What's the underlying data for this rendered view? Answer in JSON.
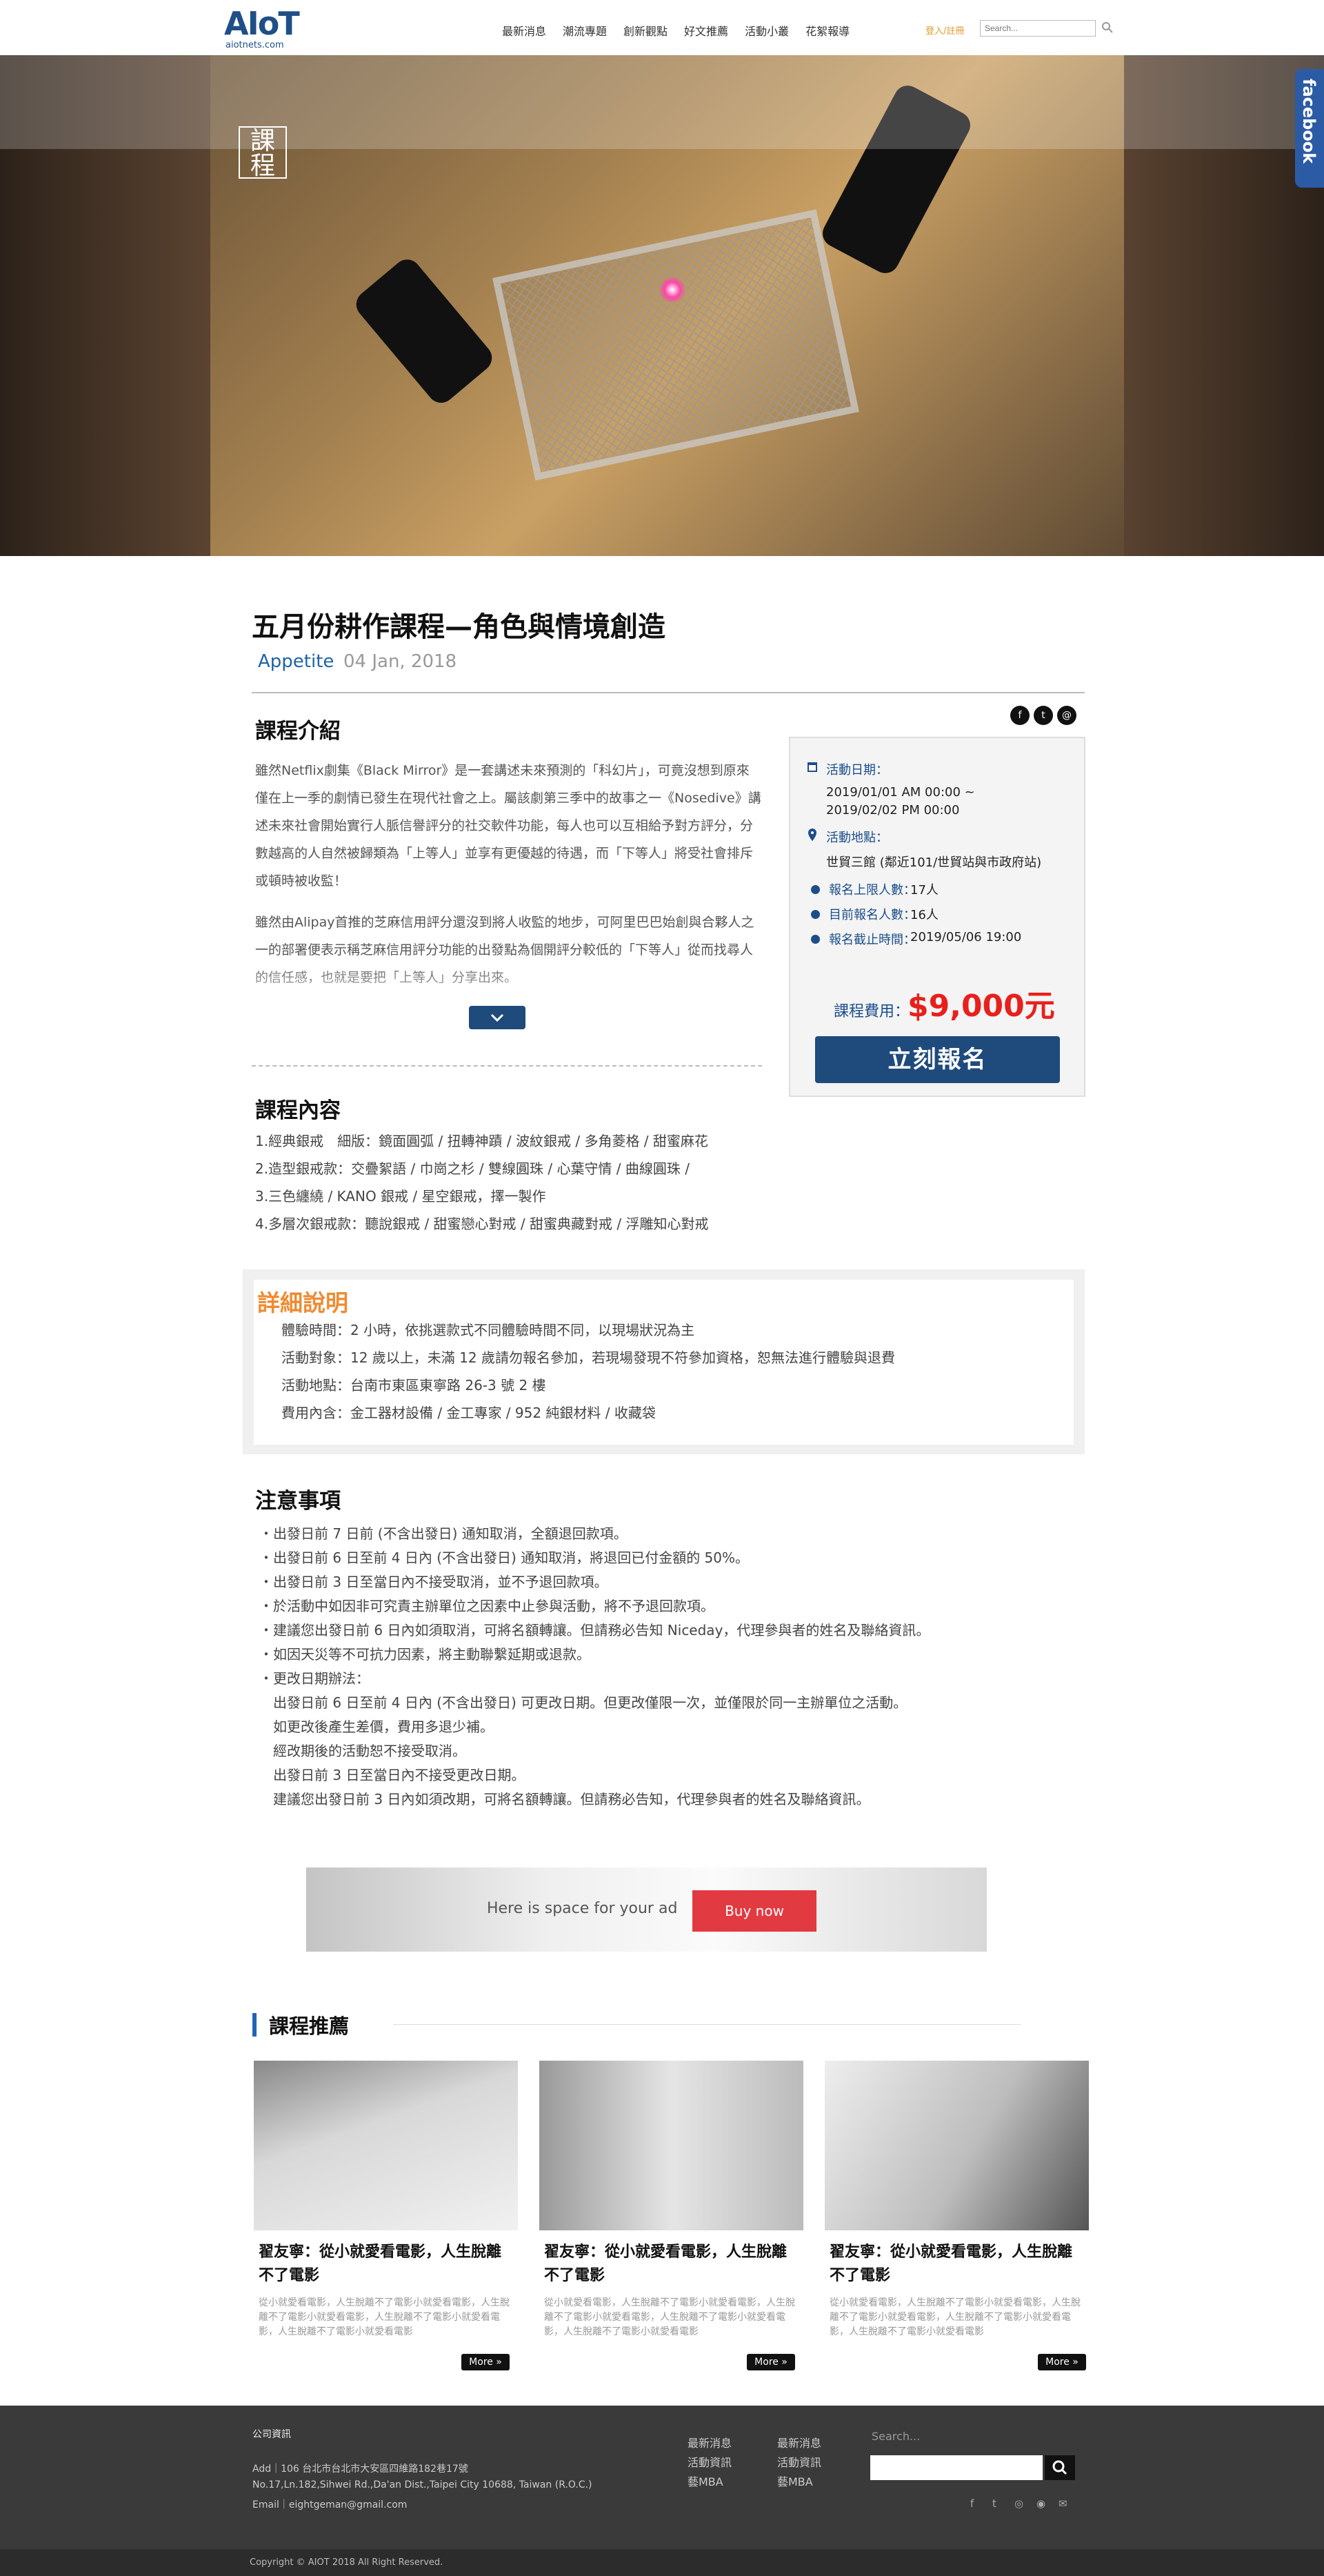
{
  "header": {
    "logo_text": "AIoT",
    "logo_sub": "aiotnets.com",
    "nav": [
      "最新消息",
      "潮流專題",
      "創新觀點",
      "好文推薦",
      "活動小叢",
      "花絮報導"
    ],
    "login": "登入/註冊",
    "search_placeholder": "Search..."
  },
  "hero": {
    "tag": "課程",
    "dots": 8,
    "active_dot": 2
  },
  "facebook_tab": "facebook",
  "article": {
    "title": "五月份耕作課程—角色與情境創造",
    "category": "Appetite",
    "date": "04 Jan, 2018"
  },
  "intro": {
    "heading": "課程介紹",
    "p1": "雖然Netflix劇集《Black Mirror》是一套講述未來預測的「科幻片」，可竟沒想到原來僅在上一季的劇情已發生在現代社會之上。屬該劇第三季中的故事之一《Nosedive》講述未來社會開始實行人脈信譽評分的社交軟件功能，每人也可以互相給予對方評分，分數越高的人自然被歸類為「上等人」並享有更優越的待遇，而「下等人」將受社會排斥或頓時被收監！",
    "p2": "雖然由Alipay首推的芝麻信用評分還沒到將人收監的地步，可阿里巴巴始創與合夥人之一的部署便表示稱芝麻信用評分功能的出發點為個開評分較低的「下等人」從而找尋人的信任感，也就是要把「上等人」分享出來。"
  },
  "social": [
    "f",
    "t",
    "@"
  ],
  "info": {
    "date_label": "活動日期：",
    "date_value_1": "2019/01/01  AM 00:00 ~",
    "date_value_2": "2019/02/02  PM 00:00",
    "place_label": "活動地點：",
    "place_value": "世貿三館 (鄰近101/世貿站與市政府站)",
    "max_label": "報名上限人數：",
    "max_value": "17人",
    "cur_label": "目前報名人數：",
    "cur_value": "16人",
    "deadline_label": "報名截止時間：",
    "deadline_value": "2019/05/06 19:00",
    "fee_label": "課程費用：",
    "fee_value": "$9,000元",
    "register": "立刻報名"
  },
  "content": {
    "heading": "課程內容",
    "items": [
      "1.經典銀戒　細版：鏡面圓弧 / 扭轉神蹟 / 波紋銀戒 / 多角菱格 / 甜蜜麻花",
      "2.造型銀戒款：交疊絮語 / 巾崗之杉 / 雙線圓珠 / 心葉守情 / 曲線圓珠 /",
      "3.三色纏繞 / KANO 銀戒 / 星空銀戒，擇一製作",
      "4.多層次銀戒款：聽說銀戒 / 甜蜜戀心對戒 / 甜蜜典藏對戒 / 浮雕知心對戒"
    ]
  },
  "detail": {
    "heading": "詳細說明",
    "items": [
      "體驗時間：2 小時，依挑選款式不同體驗時間不同，以現場狀況為主",
      "活動對象：12 歲以上，未滿 12 歲請勿報名參加，若現場發現不符參加資格，恕無法進行體驗與退費",
      "活動地點：台南市東區東寧路 26-3 號 2 樓",
      "費用內含：金工器材設備 / 金工專家 / 952 純銀材料 / 收藏袋"
    ]
  },
  "notes": {
    "heading": "注意事項",
    "items": [
      "・出發日前 7 日前 (不含出發日) 通知取消，全額退回款項。",
      "・出發日前 6 日至前 4 日內 (不含出發日) 通知取消，將退回已付金額的 50%。",
      "・出發日前 3 日至當日內不接受取消，並不予退回款項。",
      "・於活動中如因非可究責主辦單位之因素中止參與活動，將不予退回款項。",
      "・建議您出發日前 6 日內如須取消，可將名額轉讓。但請務必告知 Niceday，代理參與者的姓名及聯絡資訊。",
      "・如因天災等不可抗力因素，將主動聯繫延期或退款。",
      "・更改日期辦法：",
      "　出發日前 6 日至前 4 日內 (不含出發日) 可更改日期。但更改僅限一次，並僅限於同一主辦單位之活動。",
      "　如更改後產生差價，費用多退少補。",
      "　經改期後的活動恕不接受取消。",
      "　出發日前 3 日至當日內不接受更改日期。",
      "　建議您出發日前 3 日內如須改期，可將名額轉讓。但請務必告知，代理參與者的姓名及聯絡資訊。"
    ]
  },
  "ad": {
    "text": "Here is space for your ad",
    "button": "Buy now"
  },
  "recommend": {
    "heading": "課程推薦",
    "cards": [
      {
        "title": "翟友寧：從小就愛看電影，人生脫離不了電影",
        "desc": "從小就愛看電影，人生脫離不了電影小就愛看電影，人生脫離不了電影小就愛看電影，人生脫離不了電影小就愛看電影，人生脫離不了電影小就愛看電影",
        "more": "More »"
      },
      {
        "title": "翟友寧：從小就愛看電影，人生脫離不了電影",
        "desc": "從小就愛看電影，人生脫離不了電影小就愛看電影，人生脫離不了電影小就愛看電影，人生脫離不了電影小就愛看電影，人生脫離不了電影小就愛看電影",
        "more": "More »"
      },
      {
        "title": "翟友寧：從小就愛看電影，人生脫離不了電影",
        "desc": "從小就愛看電影，人生脫離不了電影小就愛看電影，人生脫離不了電影小就愛看電影，人生脫離不了電影小就愛看電影，人生脫離不了電影小就愛看電影",
        "more": "More »"
      }
    ]
  },
  "footer": {
    "company_heading": "公司資訊",
    "addr_line1": "Add｜106 台北市台北市大安區四維路182巷17號",
    "addr_line2": "No.17,Ln.182,Sihwei Rd.,Da'an Dist.,Taipei City 10688, Taiwan (R.O.C.)",
    "email": "Email｜eightgeman@gmail.com",
    "col1": [
      "最新消息",
      "活動資訊",
      "藝MBA"
    ],
    "col2": [
      "最新消息",
      "活動資訊",
      "藝MBA"
    ],
    "search_label": "Search...",
    "copyright": "Copyright © AIOT 2018 All Right Reserved."
  }
}
